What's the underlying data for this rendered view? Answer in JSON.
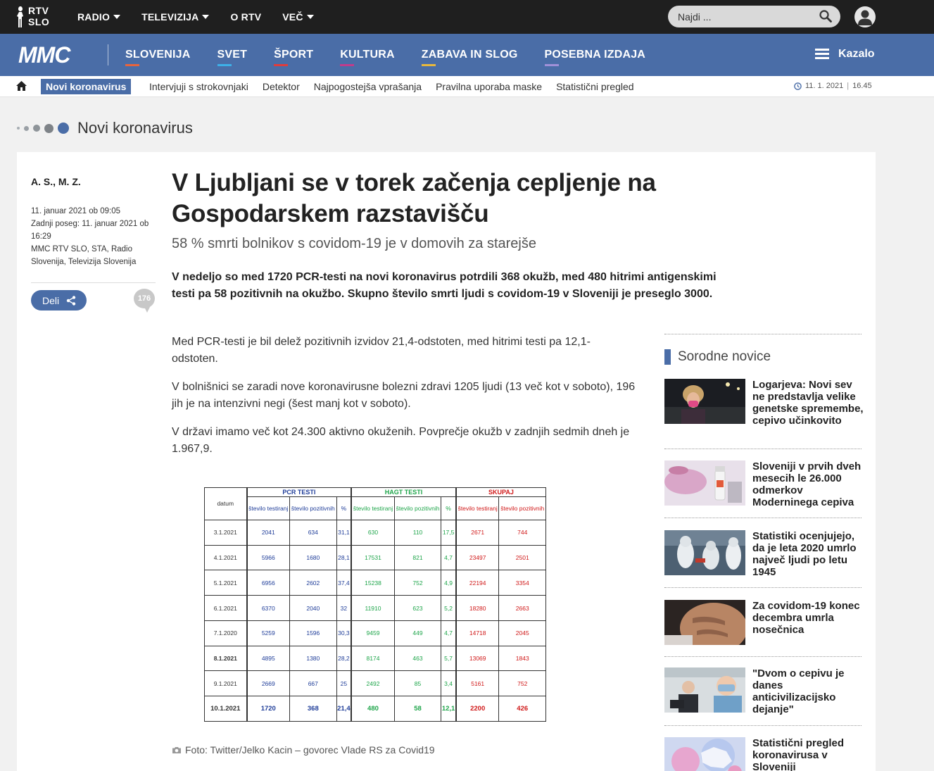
{
  "topbar": {
    "logo": {
      "line1": "RTV",
      "line2": "SLO"
    },
    "nav": [
      {
        "label": "RADIO",
        "dropdown": true
      },
      {
        "label": "TELEVIZIJA",
        "dropdown": true
      },
      {
        "label": "O RTV",
        "dropdown": false
      },
      {
        "label": "VEČ",
        "dropdown": true
      }
    ],
    "search_placeholder": "Najdi ..."
  },
  "mainbar": {
    "logo": "MMC",
    "nav": [
      {
        "label": "SLOVENIJA",
        "color": "#e8643c"
      },
      {
        "label": "SVET",
        "color": "#3db0e8"
      },
      {
        "label": "ŠPORT",
        "color": "#e03c3c"
      },
      {
        "label": "KULTURA",
        "color": "#c03c8c"
      },
      {
        "label": "ZABAVA IN SLOG",
        "color": "#e8b83c"
      },
      {
        "label": "POSEBNA IZDAJA",
        "color": "#a090d8"
      }
    ],
    "kazalo": "Kazalo"
  },
  "subnav": {
    "active": "Novi koronavirus",
    "links": [
      "Intervjuji s strokovnjaki",
      "Detektor",
      "Najpogostejša vprašanja",
      "Pravilna uporaba maske",
      "Statistični pregled"
    ],
    "date": "11. 1. 2021",
    "time": "16.45"
  },
  "section": {
    "title": "Novi koronavirus"
  },
  "article": {
    "author": "A. S., M. Z.",
    "published": "11. januar 2021 ob 09:05",
    "updated": "Zadnji poseg: 11. januar 2021 ob 16:29",
    "sources": "MMC RTV SLO, STA, Radio Slovenija, Televizija Slovenija",
    "share_label": "Deli",
    "comments": "176",
    "title": "V Ljubljani se v torek začenja cepljenje na Gospodarskem razstavišču",
    "subtitle": "58 % smrti bolnikov s covidom-19 je v domovih za starejše",
    "lead": "V nedeljo so med 1720 PCR-testi na novi koronavirus potrdili 368 okužb, med 480 hitrimi antigenskimi testi pa 58 pozitivnih na okužbo. Skupno število smrti ljudi s covidom-19 v Sloveniji je preseglo 3000.",
    "paragraphs": [
      "Med PCR-testi je bil delež pozitivnih izvidov 21,4-odstoten, med hitrimi testi pa 12,1-odstoten.",
      "V bolnišnici se zaradi nove koronavirusne bolezni zdravi 1205 ljudi (13 več kot v soboto), 196 jih je na intenzivni negi (šest manj kot v soboto).",
      "V državi imamo več kot 24.300 aktivno okuženih. Povprečje okužb v zadnjih sedmih dneh je 1.967,9."
    ],
    "caption": "Foto: Twitter/Jelko Kacin – govorec Vlade RS za Covid19"
  },
  "table": {
    "date_header": "datum",
    "groups": [
      "PCR TESTI",
      "HAGT TESTI",
      "SKUPAJ"
    ],
    "sub": {
      "tested": "število testiranj",
      "positive": "število pozitivnih",
      "pct": "%"
    },
    "rows": [
      [
        "3.1.2021",
        "2041",
        "634",
        "31,1",
        "630",
        "110",
        "17,5",
        "2671",
        "744"
      ],
      [
        "4.1.2021",
        "5966",
        "1680",
        "28,1",
        "17531",
        "821",
        "4,7",
        "23497",
        "2501"
      ],
      [
        "5.1.2021",
        "6956",
        "2602",
        "37,4",
        "15238",
        "752",
        "4,9",
        "22194",
        "3354"
      ],
      [
        "6.1.2021",
        "6370",
        "2040",
        "32",
        "11910",
        "623",
        "5,2",
        "18280",
        "2663"
      ],
      [
        "7.1.2020",
        "5259",
        "1596",
        "30,3",
        "9459",
        "449",
        "4,7",
        "14718",
        "2045"
      ],
      [
        "8.1.2021",
        "4895",
        "1380",
        "28,2",
        "8174",
        "463",
        "5,7",
        "13069",
        "1843"
      ],
      [
        "9.1.2021",
        "2669",
        "667",
        "25",
        "2492",
        "85",
        "3,4",
        "5161",
        "752"
      ],
      [
        "10.1.2021",
        "1720",
        "368",
        "21,4",
        "480",
        "58",
        "12,1",
        "2200",
        "426"
      ]
    ]
  },
  "related": {
    "heading": "Sorodne novice",
    "items": [
      {
        "title": "Logarjeva: Novi sev ne predstavlja velike genetske spremembe, cepivo učinkovito"
      },
      {
        "title": "Sloveniji v prvih dveh mesecih le 26.000 odmerkov Moderninega cepiva"
      },
      {
        "title": "Statistiki ocenjujejo, da je leta 2020 umrlo največ ljudi po letu 1945"
      },
      {
        "title": "Za covidom-19 konec decembra umrla nosečnica"
      },
      {
        "title": "\"Dvom o cepivu je danes anticivilizacijsko dejanje\""
      },
      {
        "title": "Statistični pregled koronavirusa v Sloveniji"
      }
    ]
  }
}
